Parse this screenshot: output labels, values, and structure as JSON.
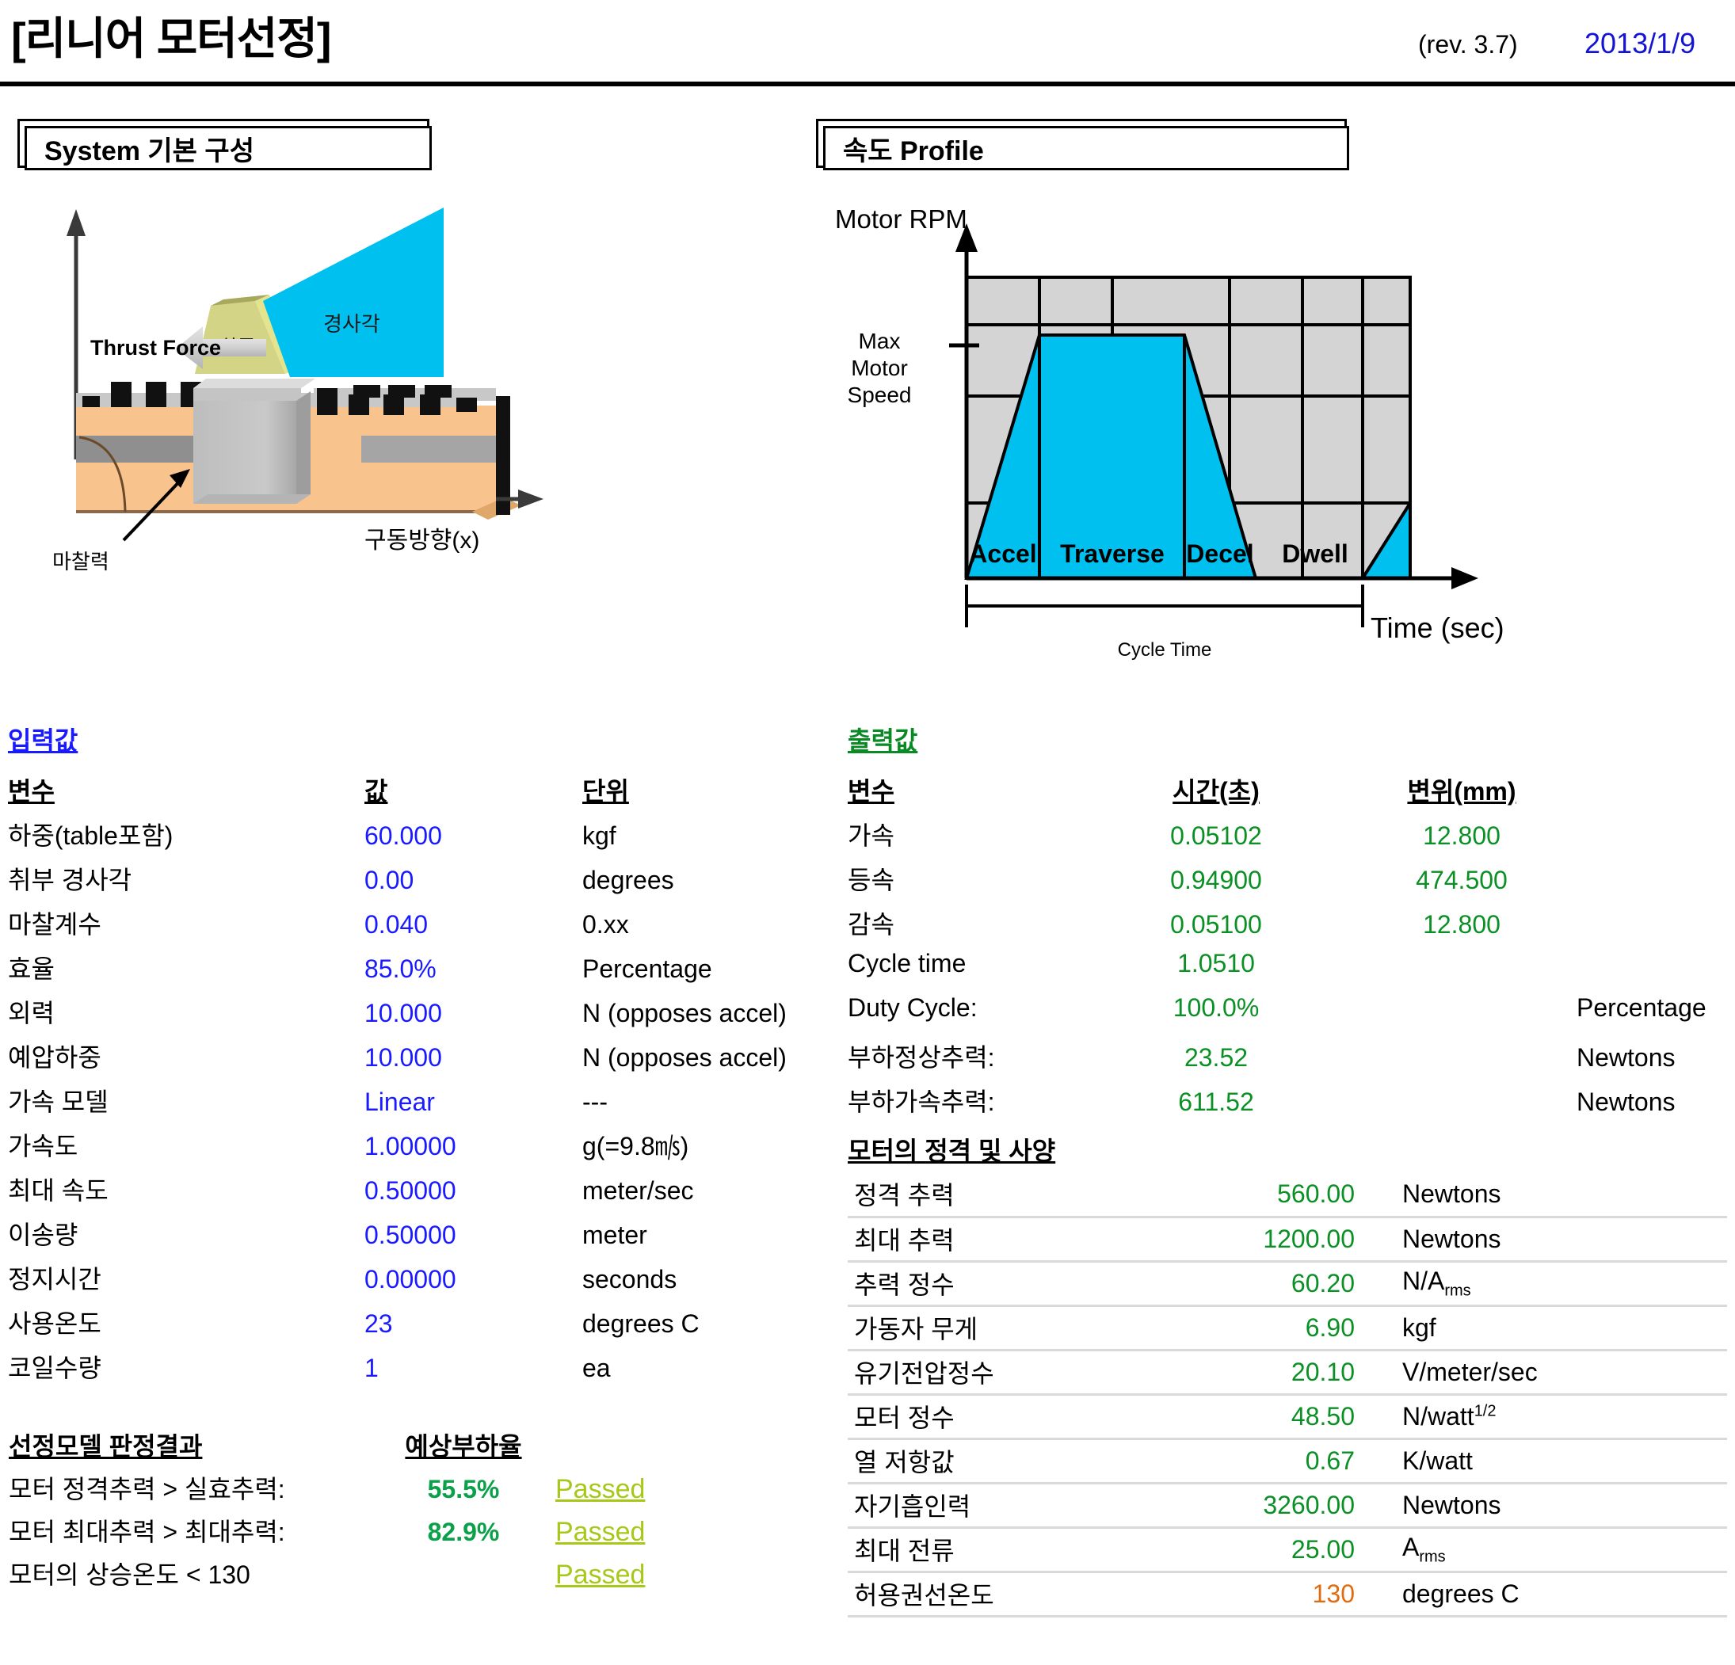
{
  "header": {
    "title": "[리니어 모터선정]",
    "revision": "(rev. 3.7)",
    "date": "2013/1/9"
  },
  "sections": {
    "system_title": "System 기본 구성",
    "profile_title": "속도 Profile"
  },
  "schematic": {
    "thrust_label": "Thrust Force",
    "load_label": "하중",
    "incline_label": "경사각",
    "friction_label": "마찰력",
    "axis_label": "구동방향(x)"
  },
  "chart_data": {
    "type": "area",
    "title": "속도 Profile",
    "ylabel": "Motor RPM",
    "xlabel": "Time (sec)",
    "y_tick_label": "Max Motor Speed",
    "cycle_label": "Cycle Time",
    "grid": true,
    "segments": [
      "Accel",
      "Traverse",
      "Decel",
      "Dwell"
    ],
    "x": [
      0,
      0.17,
      0.44,
      0.72,
      0.86,
      1.0
    ],
    "y": [
      0,
      1.0,
      1.0,
      0,
      0,
      0.28
    ],
    "ylim": [
      0,
      1.4
    ],
    "xlim": [
      0,
      1.15
    ],
    "series": [
      {
        "name": "Motor speed profile",
        "points": [
          [
            0,
            0
          ],
          [
            0.17,
            1.0
          ],
          [
            0.44,
            1.0
          ],
          [
            0.72,
            0
          ],
          [
            0.86,
            0
          ],
          [
            1.0,
            0.28
          ]
        ]
      }
    ],
    "annotations": [
      "Accel",
      "Traverse",
      "Decel",
      "Dwell",
      "Cycle Time"
    ]
  },
  "input": {
    "title": "입력값",
    "columns": [
      "변수",
      "값",
      "단위"
    ],
    "rows": [
      {
        "name": "하중(table포함)",
        "value": "60.000",
        "unit": "kgf"
      },
      {
        "name": "취부 경사각",
        "value": "0.00",
        "unit": "degrees"
      },
      {
        "name": "마찰계수",
        "value": "0.040",
        "unit": "0.xx"
      },
      {
        "name": "효율",
        "value": "85.0%",
        "unit": "Percentage"
      },
      {
        "name": "외력",
        "value": "10.000",
        "unit": "N (opposes accel)"
      },
      {
        "name": "예압하중",
        "value": "10.000",
        "unit": "N (opposes accel)"
      },
      {
        "name": "가속 모델",
        "value": "Linear",
        "unit": "---"
      },
      {
        "name": "가속도",
        "value": "1.00000",
        "unit": "g(=9.8㎧)"
      },
      {
        "name": "최대 속도",
        "value": "0.50000",
        "unit": "meter/sec"
      },
      {
        "name": "이송량",
        "value": "0.50000",
        "unit": "meter"
      },
      {
        "name": "정지시간",
        "value": "0.00000",
        "unit": "seconds"
      },
      {
        "name": "사용온도",
        "value": "23",
        "unit": "degrees C"
      },
      {
        "name": "코일수량",
        "value": "1",
        "unit": "ea"
      }
    ]
  },
  "output": {
    "title": "출력값",
    "columns": [
      "변수",
      "시간(초)",
      "변위(mm)"
    ],
    "rows": [
      {
        "name": "가속",
        "time": "0.05102",
        "disp": "12.800",
        "unit": ""
      },
      {
        "name": "등속",
        "time": "0.94900",
        "disp": "474.500",
        "unit": ""
      },
      {
        "name": "감속",
        "time": "0.05100",
        "disp": "12.800",
        "unit": ""
      }
    ],
    "summary": [
      {
        "name": "Cycle time",
        "value": "1.0510",
        "unit": ""
      },
      {
        "name": "Duty Cycle:",
        "value": "100.0%",
        "unit": "Percentage"
      },
      {
        "name": "부하정상추력:",
        "value": "23.52",
        "unit": "Newtons"
      },
      {
        "name": "부하가속추력:",
        "value": "611.52",
        "unit": "Newtons"
      }
    ]
  },
  "motor_spec": {
    "title": "모터의 정격 및 사양",
    "rows": [
      {
        "name": "정격 추력",
        "value": "560.00",
        "unit": "Newtons",
        "warn": false
      },
      {
        "name": "최대 추력",
        "value": "1200.00",
        "unit": "Newtons",
        "warn": false
      },
      {
        "name": "추력 정수",
        "value": "60.20",
        "unit": "N/Arms",
        "warn": false
      },
      {
        "name": "가동자 무게",
        "value": "6.90",
        "unit": "kgf",
        "warn": false
      },
      {
        "name": "유기전압정수",
        "value": "20.10",
        "unit": "V/meter/sec",
        "warn": false
      },
      {
        "name": "모터 정수",
        "value": "48.50",
        "unit": "N/watt1/2",
        "warn": false
      },
      {
        "name": "열 저항값",
        "value": "0.67",
        "unit": "K/watt",
        "warn": false
      },
      {
        "name": "자기흡인력",
        "value": "3260.00",
        "unit": "Newtons",
        "warn": false
      },
      {
        "name": "최대 전류",
        "value": "25.00",
        "unit": "Arms",
        "warn": false
      },
      {
        "name": "허용권선온도",
        "value": "130",
        "unit": "degrees C",
        "warn": true
      }
    ]
  },
  "verdict": {
    "title": "선정모델 판정결과",
    "pct_header": "예상부하율",
    "rows": [
      {
        "name": "모터 정격추력 > 실효추력:",
        "pct": "55.5%",
        "result": "Passed"
      },
      {
        "name": "모터 최대추력 > 최대추력:",
        "pct": "82.9%",
        "result": "Passed"
      },
      {
        "name": "모터의 상승온도 < 130",
        "pct": "",
        "result": "Passed"
      }
    ]
  },
  "colors": {
    "input_blue": "#1a1aff",
    "output_green": "#0a9024",
    "pass_olive": "#a6c818",
    "warn_orange": "#e06c10",
    "chart_cyan": "#00c0f0",
    "chart_grid_fill": "#d4d4d4"
  }
}
